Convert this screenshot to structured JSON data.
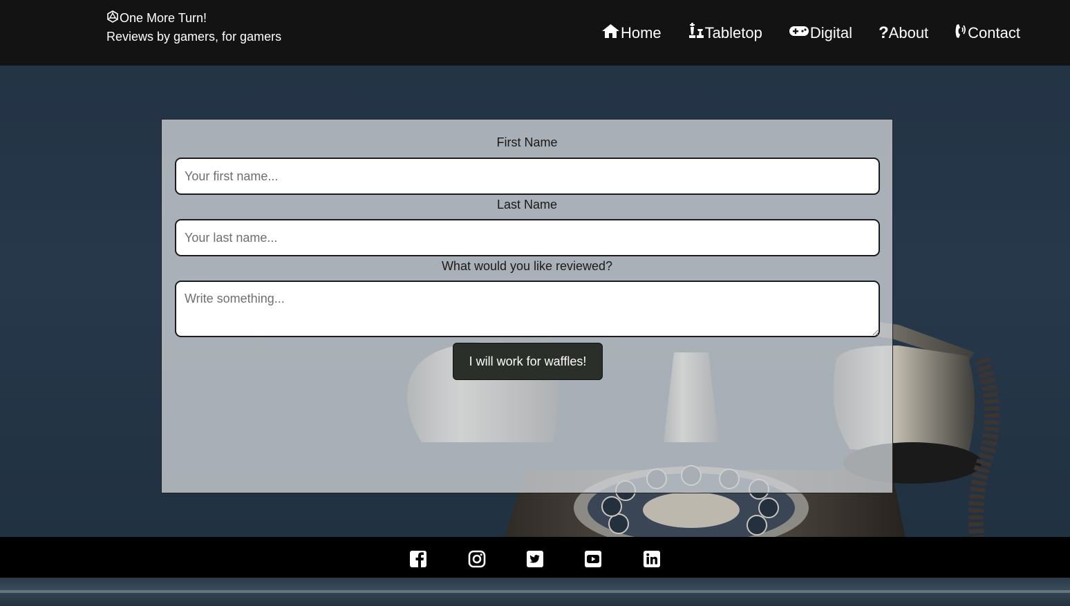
{
  "header": {
    "brand_title": "One More Turn!",
    "brand_tagline": "Reviews by gamers, for gamers",
    "logo_icon": "d20-dice-icon",
    "nav": [
      {
        "label": "Home",
        "icon": "house-icon"
      },
      {
        "label": "Tabletop",
        "icon": "chess-icon"
      },
      {
        "label": "Digital",
        "icon": "gamepad-icon"
      },
      {
        "label": "About",
        "icon": "question-icon"
      },
      {
        "label": "Contact",
        "icon": "phone-volume-icon"
      }
    ]
  },
  "form": {
    "first_name_label": "First Name",
    "first_name_placeholder": "Your first name...",
    "first_name_value": "",
    "last_name_label": "Last Name",
    "last_name_placeholder": "Your last name...",
    "last_name_value": "",
    "review_label": "What would you like reviewed?",
    "review_placeholder": "Write something...",
    "review_value": "",
    "submit_label": "I will work for waffles!"
  },
  "footer": {
    "social": [
      "facebook-icon",
      "instagram-icon",
      "twitter-icon",
      "youtube-icon",
      "linkedin-icon"
    ]
  },
  "colors": {
    "header_bg": "#131313",
    "footer_bg": "#000000",
    "button_bg": "#2a2f2a",
    "page_bg": "#223243"
  }
}
